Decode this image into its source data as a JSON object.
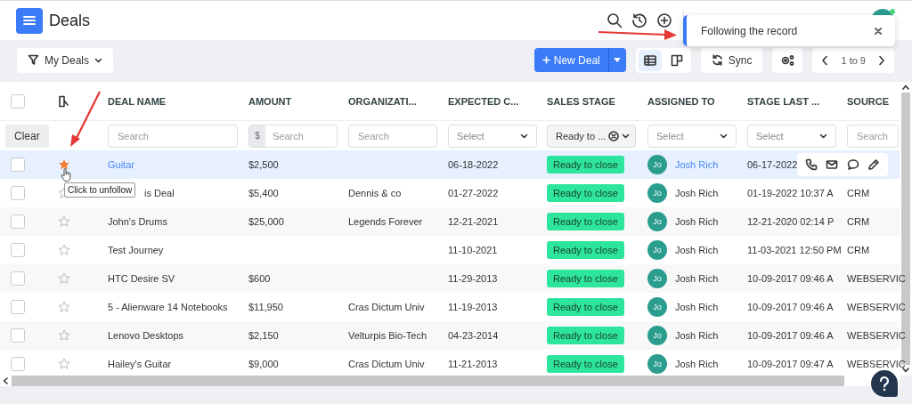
{
  "header": {
    "title": "Deals"
  },
  "toast": {
    "message": "Following the record"
  },
  "toolbar": {
    "filter": "My Deals",
    "new_button": "New Deal",
    "views": [
      {
        "kind": "list",
        "selected": true
      },
      {
        "kind": "board",
        "selected": false
      }
    ],
    "sync": "Sync",
    "pagination": "1 to 9"
  },
  "table": {
    "select_all": {
      "checked": false
    },
    "columns": [
      "DEAL NAME",
      "AMOUNT",
      "ORGANIZATI...",
      "EXPECTED C...",
      "SALES STAGE",
      "ASSIGNED TO",
      "STAGE LAST ...",
      "SOURCE"
    ],
    "filters": [
      {
        "kind": "clear",
        "label": "Clear"
      },
      {
        "kind": "search",
        "placeholder": "Search"
      },
      {
        "kind": "currency",
        "prefix": "$",
        "placeholder": "Search"
      },
      {
        "kind": "search",
        "placeholder": "Search"
      },
      {
        "kind": "select",
        "placeholder": "Select"
      },
      {
        "kind": "chosen",
        "value": "Ready to ..."
      },
      {
        "kind": "select",
        "placeholder": "Select"
      },
      {
        "kind": "select",
        "placeholder": "Select"
      },
      {
        "kind": "search",
        "placeholder": "Search"
      }
    ],
    "rows": [
      {
        "checked": false,
        "following": true,
        "hovered": true,
        "tooltip": "Click to unfollow",
        "name": "Guitar",
        "amount": "$2,500",
        "organization": "",
        "expected_close": "06-18-2022",
        "stage": "Ready to close",
        "avatar": "Jo",
        "assigned_to": "Josh Rich",
        "stage_last": "06-17-2022",
        "source": ""
      },
      {
        "checked": false,
        "following": false,
        "hovered": false,
        "name": "is Deal",
        "amount": "$5,400",
        "organization": "Dennis & co",
        "expected_close": "01-27-2022",
        "stage": "Ready to close",
        "avatar": "Jo",
        "assigned_to": "Josh Rich",
        "stage_last": "01-19-2022 10:37 A",
        "source": "CRM"
      },
      {
        "checked": false,
        "following": false,
        "hovered": false,
        "name": "John's Drums",
        "amount": "$25,000",
        "organization": "Legends Forever",
        "expected_close": "12-21-2021",
        "stage": "Ready to close",
        "avatar": "Jo",
        "assigned_to": "Josh Rich",
        "stage_last": "12-21-2020 02:14 P",
        "source": "CRM"
      },
      {
        "checked": false,
        "following": false,
        "hovered": false,
        "name": "Test Journey",
        "amount": "",
        "organization": "",
        "expected_close": "11-10-2021",
        "stage": "Ready to close",
        "avatar": "Jo",
        "assigned_to": "Josh Rich",
        "stage_last": "11-03-2021 12:50 PM",
        "source": "CRM"
      },
      {
        "checked": false,
        "following": false,
        "hovered": false,
        "name": "HTC Desire SV",
        "amount": "$600",
        "organization": "",
        "expected_close": "11-29-2013",
        "stage": "Ready to close",
        "avatar": "Jo",
        "assigned_to": "Josh Rich",
        "stage_last": "10-09-2017 09:46 A",
        "source": "WEBSERVIC"
      },
      {
        "checked": false,
        "following": false,
        "hovered": false,
        "name": "5 - Alienware 14 Notebooks",
        "amount": "$11,950",
        "organization": "Cras Dictum Univ",
        "expected_close": "11-19-2013",
        "stage": "Ready to close",
        "avatar": "Jo",
        "assigned_to": "Josh Rich",
        "stage_last": "10-09-2017 09:46 A",
        "source": "WEBSERVIC"
      },
      {
        "checked": false,
        "following": false,
        "hovered": false,
        "name": "Lenovo Desktops",
        "amount": "$2,150",
        "organization": "Velturpis Bio-Tech",
        "expected_close": "04-23-2014",
        "stage": "Ready to close",
        "avatar": "Jo",
        "assigned_to": "Josh Rich",
        "stage_last": "10-09-2017 09:46 A",
        "source": "WEBSERVIC"
      },
      {
        "checked": false,
        "following": false,
        "hovered": false,
        "name": "Hailey's Guitar",
        "amount": "$9,000",
        "organization": "Cras Dictum Univ",
        "expected_close": "11-21-2013",
        "stage": "Ready to close",
        "avatar": "Jo",
        "assigned_to": "Josh Rich",
        "stage_last": "10-09-2017 09:47 A",
        "source": "WEBSERVIC"
      }
    ]
  }
}
